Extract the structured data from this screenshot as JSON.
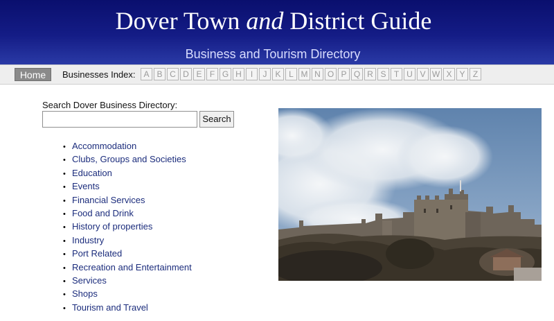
{
  "header": {
    "title_part1": "Dover Town ",
    "title_part2": "and",
    "title_part3": " District Guide",
    "subtitle": "Business and Tourism Directory"
  },
  "navbar": {
    "home_label": "Home",
    "index_label": "Businesses Index:",
    "letters": [
      "A",
      "B",
      "C",
      "D",
      "E",
      "F",
      "G",
      "H",
      "I",
      "J",
      "K",
      "L",
      "M",
      "N",
      "O",
      "P",
      "Q",
      "R",
      "S",
      "T",
      "U",
      "V",
      "W",
      "X",
      "Y",
      "Z"
    ]
  },
  "search": {
    "label": "Search Dover Business Directory:",
    "input_value": "",
    "button_label": "Search"
  },
  "categories": [
    "Accommodation",
    "Clubs, Groups and Societies",
    "Education",
    "Events",
    "Financial Services",
    "Food and Drink",
    "History of properties",
    "Industry",
    "Port Related",
    "Recreation and Entertainment",
    "Services",
    "Shops",
    "Tourism and Travel"
  ],
  "colors": {
    "header_dark": "#0a0f6e",
    "header_light": "#2a3aa6",
    "link": "#1b2c7c",
    "home_button": "#8a8a8a"
  }
}
